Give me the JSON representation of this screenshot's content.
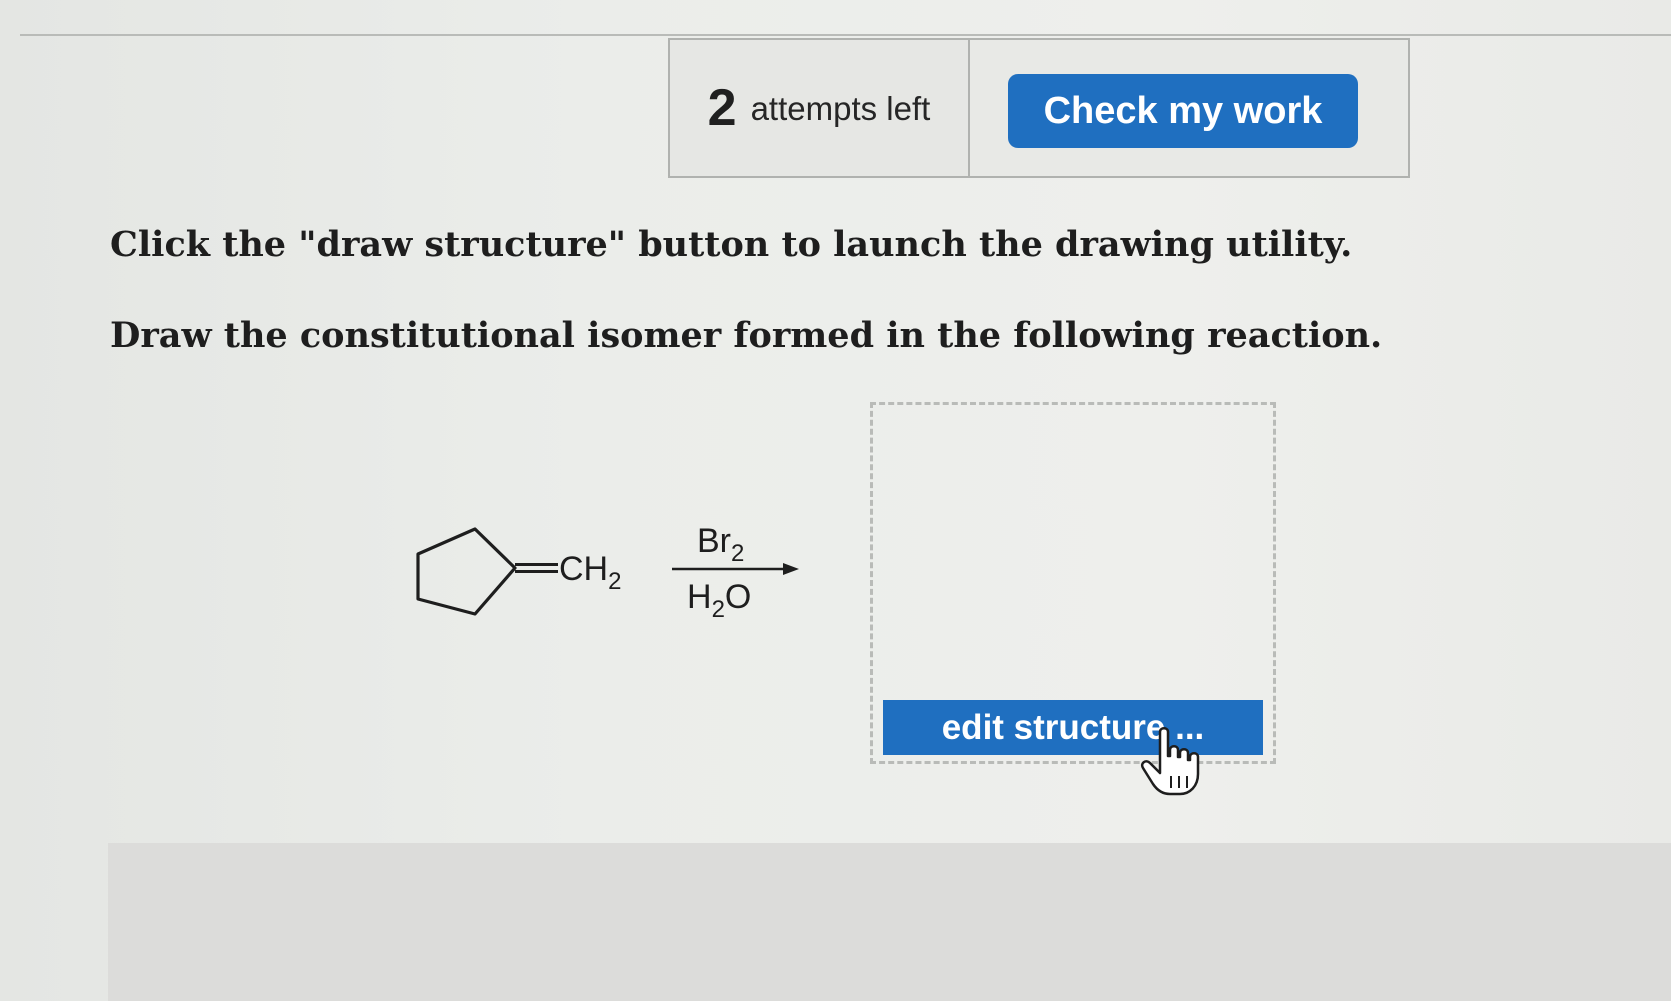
{
  "toolbar": {
    "attempts_count": "2",
    "attempts_label": "attempts left",
    "check_button_label": "Check my work"
  },
  "question": {
    "instruction_line": "Click the \"draw structure\" button to launch the drawing utility.",
    "prompt_line": "Draw the constitutional isomer formed in the following reaction."
  },
  "reaction": {
    "substituent": "CH",
    "substituent_subscript": "2",
    "reagent_top": "Br",
    "reagent_top_subscript": "2",
    "reagent_bottom_h": "H",
    "reagent_bottom_subscript": "2",
    "reagent_bottom_o": "O"
  },
  "answer": {
    "edit_button_label": "edit structure ..."
  },
  "colors": {
    "button_blue": "#1f6fc0",
    "background": "#ebedea"
  },
  "icons": {
    "cursor": "hand-pointer-icon"
  }
}
